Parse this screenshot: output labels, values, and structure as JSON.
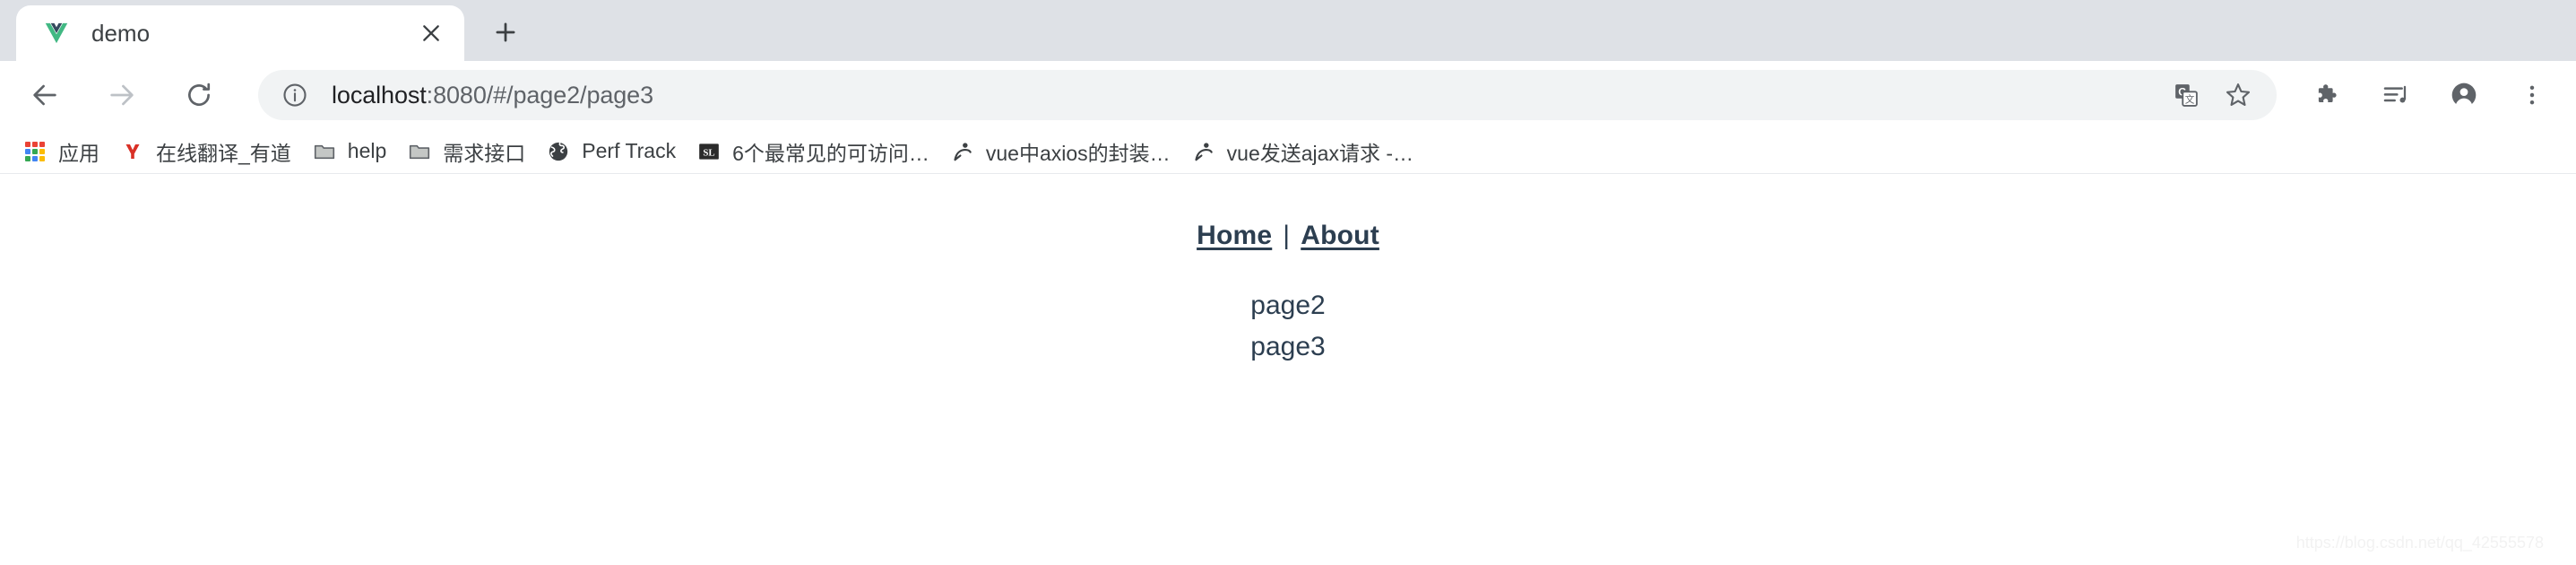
{
  "browser": {
    "tab": {
      "title": "demo",
      "favicon_name": "vue-logo-icon",
      "close_label": "×"
    },
    "new_tab_label": "+",
    "nav": {
      "back_label": "←",
      "forward_label": "→",
      "reload_label": "↻"
    },
    "omnibox": {
      "host": "localhost",
      "path": ":8080/#/page2/page3",
      "full_url": "localhost:8080/#/page2/page3",
      "info_icon": "site-info-icon"
    },
    "toolbar_icons": [
      {
        "name": "translate-icon",
        "label": "Google Translate"
      },
      {
        "name": "bookmark-star-icon",
        "label": "Bookmark this tab"
      },
      {
        "name": "extensions-puzzle-icon",
        "label": "Extensions"
      },
      {
        "name": "media-control-icon",
        "label": "Media controls"
      },
      {
        "name": "profile-avatar-icon",
        "label": "Profile"
      },
      {
        "name": "kebab-menu-icon",
        "label": "Customize and control"
      }
    ],
    "bookmarks": [
      {
        "label": "应用",
        "icon": "apps-grid-icon"
      },
      {
        "label": "在线翻译_有道",
        "icon": "youdao-icon"
      },
      {
        "label": "help",
        "icon": "folder-icon"
      },
      {
        "label": "需求接口",
        "icon": "folder-icon"
      },
      {
        "label": "Perf Track",
        "icon": "globe-icon"
      },
      {
        "label": "6个最常见的可访问…",
        "icon": "sl-badge-icon"
      },
      {
        "label": "vue中axios的封装…",
        "icon": "csdn-icon"
      },
      {
        "label": "vue发送ajax请求 -…",
        "icon": "csdn-icon"
      }
    ]
  },
  "page": {
    "nav_links": [
      {
        "label": "Home"
      },
      {
        "label": "About"
      }
    ],
    "nav_separator": "|",
    "content_lines": [
      "page2",
      "page3"
    ],
    "watermark": "https://blog.csdn.net/qq_42555578"
  },
  "colors": {
    "vue_green": "#41b883",
    "vue_dark": "#35495e",
    "app_text": "#2c3e50",
    "chrome_tabstrip": "#dee1e6",
    "omnibox_bg": "#f1f3f4"
  }
}
